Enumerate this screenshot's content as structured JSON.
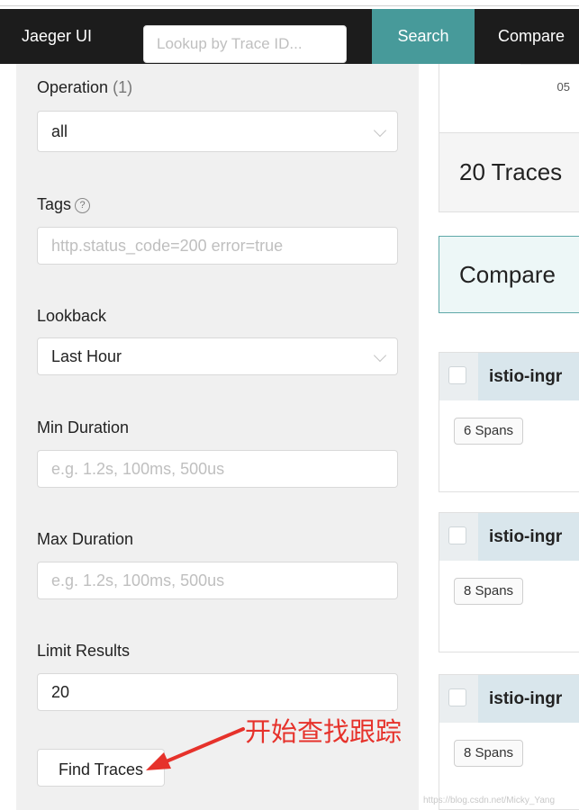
{
  "navbar": {
    "brand": "Jaeger UI",
    "lookup_placeholder": "Lookup by Trace ID...",
    "search_label": "Search",
    "compare_label": "Compare"
  },
  "form": {
    "operation": {
      "label": "Operation",
      "count": "(1)",
      "value": "all"
    },
    "tags": {
      "label": "Tags",
      "help": "?",
      "placeholder": "http.status_code=200 error=true"
    },
    "lookback": {
      "label": "Lookback",
      "value": "Last Hour"
    },
    "min_duration": {
      "label": "Min Duration",
      "placeholder": "e.g. 1.2s, 100ms, 500us"
    },
    "max_duration": {
      "label": "Max Duration",
      "placeholder": "e.g. 1.2s, 100ms, 500us"
    },
    "limit": {
      "label": "Limit Results",
      "value": "20"
    },
    "find_button": "Find Traces"
  },
  "annotation": {
    "text": "开始查找跟踪",
    "color": "#e6322b"
  },
  "results": {
    "timestamp": "05",
    "count_title": "20 Traces",
    "compare_title": "Compare",
    "traces": [
      {
        "name": "istio-ingr",
        "spans": "6 Spans"
      },
      {
        "name": "istio-ingr",
        "spans": "8 Spans"
      },
      {
        "name": "istio-ingr",
        "spans": "8 Spans"
      }
    ]
  },
  "watermark": "https://blog.csdn.net/Micky_Yang",
  "colors": {
    "navbar": "#1c1c1c",
    "accent": "#479a9a",
    "annotation": "#e6322b"
  }
}
